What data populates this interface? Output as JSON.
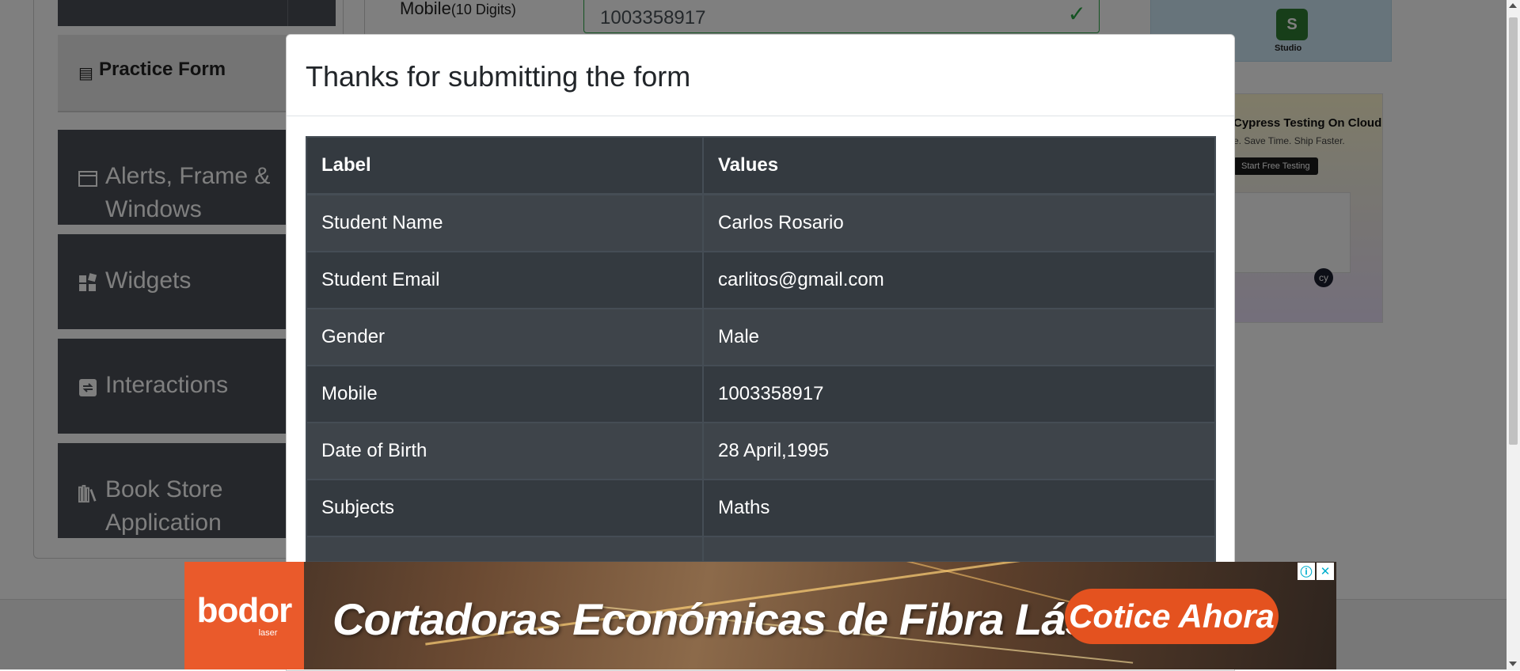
{
  "sidebar": {
    "practice_form": "Practice Form",
    "items": [
      {
        "label": "Alerts, Frame &",
        "label2": "Windows",
        "icon": "window-icon"
      },
      {
        "label": "Widgets",
        "icon": "widgets-icon"
      },
      {
        "label": "Interactions",
        "icon": "interactions-icon"
      },
      {
        "label": "Book Store",
        "label2": "Application",
        "icon": "books-icon"
      }
    ]
  },
  "form": {
    "mobile_label": "Mobile",
    "mobile_hint": "(10 Digits)",
    "mobile_value": "1003358917"
  },
  "right_ads": {
    "studio_label": "Studio",
    "studio_badge": "S",
    "cypress_title": "Cypress Testing On Cloud",
    "cypress_sub": "e. Save Time. Ship Faster.",
    "cypress_cta": "Start Free Testing",
    "cypress_logo": "cy"
  },
  "modal": {
    "title": "Thanks for submitting the form",
    "headers": [
      "Label",
      "Values"
    ],
    "rows": [
      {
        "label": "Student Name",
        "value": "Carlos Rosario"
      },
      {
        "label": "Student Email",
        "value": "carlitos@gmail.com"
      },
      {
        "label": "Gender",
        "value": "Male"
      },
      {
        "label": "Mobile",
        "value": "1003358917"
      },
      {
        "label": "Date of Birth",
        "value": "28 April,1995"
      },
      {
        "label": "Subjects",
        "value": "Maths"
      }
    ]
  },
  "bottom_ad": {
    "brand": "bodor",
    "brand_sub": "laser",
    "headline": "Cortadoras Económicas de Fibra Láser",
    "cta": "Cotice Ahora",
    "info_glyph": "ⓘ",
    "close_glyph": "✕"
  },
  "colors": {
    "table_dark": "#343a40",
    "table_stripe": "#3e444a",
    "valid_green": "#28a745",
    "ad_orange": "#ea5a2b"
  }
}
